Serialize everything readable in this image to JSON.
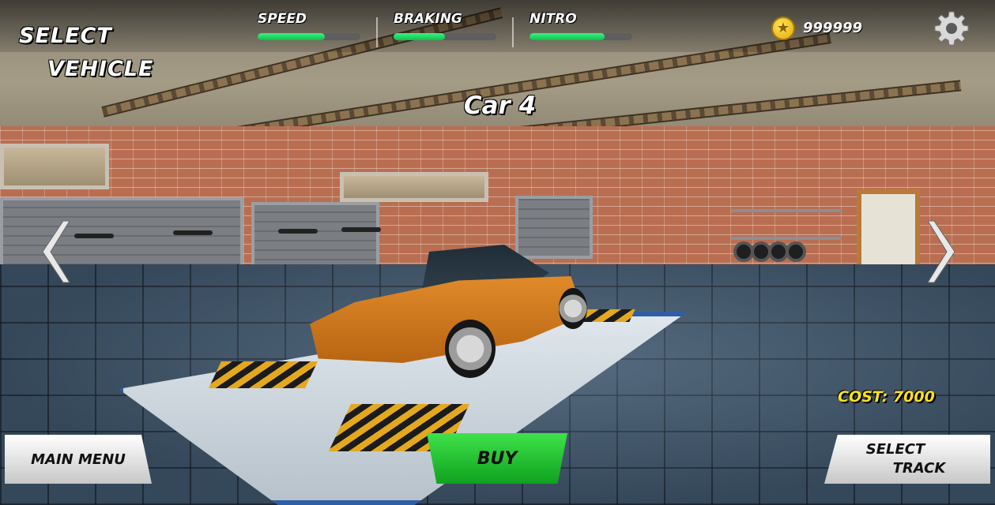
{
  "screen": {
    "title_line1": "SELECT",
    "title_line2": "VEHICLE"
  },
  "stats": [
    {
      "label": "SPEED",
      "value": 0.65
    },
    {
      "label": "BRAKING",
      "value": 0.5
    },
    {
      "label": "NITRO",
      "value": 0.73
    }
  ],
  "currency": {
    "amount": "999999",
    "icon": "star-coin-icon"
  },
  "settings": {
    "icon": "gear-icon"
  },
  "vehicle": {
    "name": "Car 4",
    "cost_label": "COST: 7000",
    "color": "#d97a1e"
  },
  "navigation": {
    "prev_icon": "chevron-left-icon",
    "next_icon": "chevron-right-icon"
  },
  "buttons": {
    "main_menu": "MAIN MENU",
    "buy": "BUY",
    "select_track_line1": "SELECT",
    "select_track_line2": "TRACK"
  },
  "colors": {
    "stat_fill": "#1fd35e",
    "buy_button": "#19b82a",
    "cost_text": "#ffe21a"
  }
}
